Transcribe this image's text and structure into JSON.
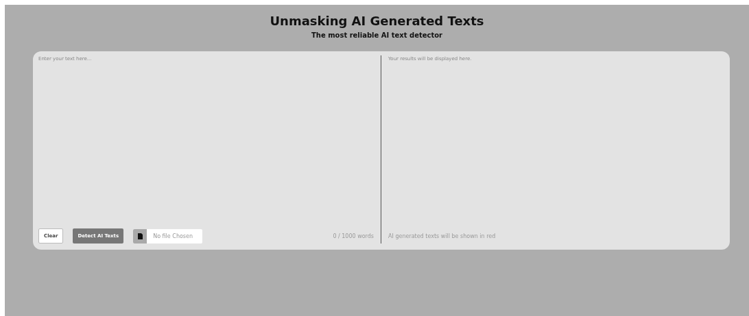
{
  "header": {
    "title": "Unmasking AI Generated Texts",
    "subtitle": "The most reliable AI text detector"
  },
  "input": {
    "placeholder": "Enter your text here...",
    "word_count": "0 / 1000 words"
  },
  "buttons": [
    {
      "kind": "clear",
      "label": "Clear"
    },
    {
      "kind": "primary",
      "label": "Detect AI Texts"
    }
  ],
  "file_picker": {
    "status": "No file Chosen"
  },
  "results": {
    "placeholder": "Your results will be displayed here.",
    "note": "AI generated texts will be shown in red"
  }
}
